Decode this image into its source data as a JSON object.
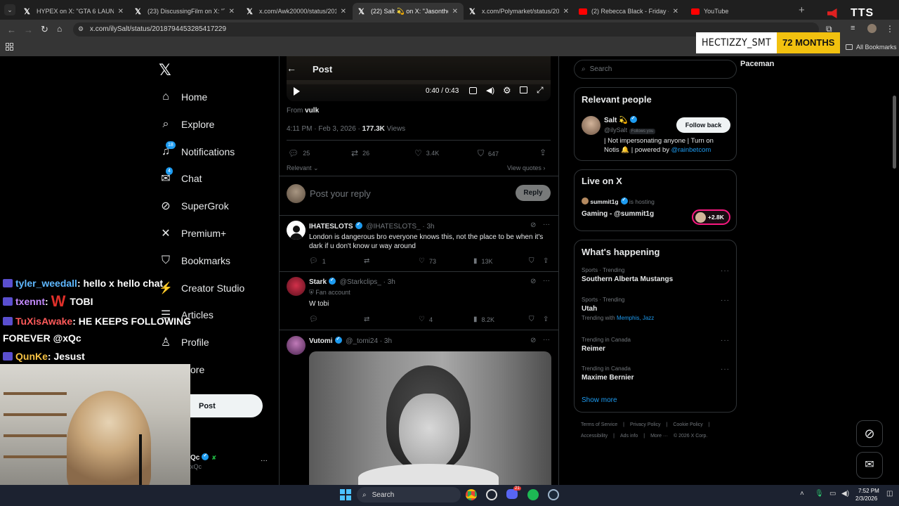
{
  "browser": {
    "tabs": [
      {
        "label": "HYPEX on X: \"GTA 6 LAUNCH M",
        "icon": "x-logo"
      },
      {
        "label": "(23) DiscussingFilm on X: \"Take",
        "icon": "x-logo"
      },
      {
        "label": "x.com/Awk20000/status/2018:",
        "icon": "x-logo"
      },
      {
        "label": "(22) Salt 💫 on X: \"Jasonthewe",
        "icon": "x-logo"
      },
      {
        "label": "x.com/Polymarket/status/2018",
        "icon": "x-logo"
      },
      {
        "label": "(2) Rebecca Black - Friday - You",
        "icon": "youtube"
      },
      {
        "label": "YouTube",
        "icon": "youtube"
      }
    ],
    "active_tab": 3,
    "url": "x.com/ilySalt/status/2018794453285417229",
    "all_bookmarks": "All Bookmarks"
  },
  "sub_badge": {
    "name": "HECTIZZY_SMT",
    "months": "72 MONTHS"
  },
  "tts_label": "TTS",
  "nav": {
    "items": [
      {
        "label": "Home",
        "icon": "home-icon"
      },
      {
        "label": "Explore",
        "icon": "search-icon"
      },
      {
        "label": "Notifications",
        "icon": "bell-icon",
        "badge": "18"
      },
      {
        "label": "Chat",
        "icon": "mail-icon",
        "badge": "4"
      },
      {
        "label": "SuperGrok",
        "icon": "grok-icon"
      },
      {
        "label": "Premium+",
        "icon": "x-icon"
      },
      {
        "label": "Bookmarks",
        "icon": "bookmark-icon"
      },
      {
        "label": "Creator Studio",
        "icon": "creator-icon"
      },
      {
        "label": "Articles",
        "icon": "article-icon"
      },
      {
        "label": "Profile",
        "icon": "person-icon"
      },
      {
        "label": "ore",
        "icon": "more-icon"
      }
    ],
    "post_button": "Post",
    "account_name": "Qc",
    "account_handle": "xQc"
  },
  "post": {
    "header_title": "Post",
    "video_time": "0:40 / 0:43",
    "from_label": "From",
    "from_name": "vulk",
    "time": "4:11 PM · Feb 3, 2026 · ",
    "views_count": "177.3K",
    "views_label": " Views",
    "stats": {
      "replies": "25",
      "reposts": "26",
      "likes": "3.4K",
      "bookmarks": "647"
    },
    "relevant": "Relevant",
    "view_quotes": "View quotes",
    "reply_placeholder": "Post your reply",
    "reply_button": "Reply"
  },
  "replies": [
    {
      "name": "IHATESLOTS",
      "handle": "@IHATESLOTS_ · 3h",
      "text": "London is dangerous bro everyone knows this, not the place to be when it's dark if u don't know ur way around",
      "stats": {
        "replies": "1",
        "reposts": "",
        "likes": "73",
        "views": "13K"
      }
    },
    {
      "name": "Stark",
      "handle": "@Starkclips_ · 3h",
      "badge": "Fan account",
      "text": "W tobi",
      "stats": {
        "replies": "",
        "reposts": "",
        "likes": "4",
        "views": "8.2K"
      }
    },
    {
      "name": "Vutomi",
      "handle": "@_tomi24 · 3h",
      "text": ""
    }
  ],
  "right": {
    "search_placeholder": "Search",
    "pacemann": "Paceman",
    "relevant_people": {
      "title": "Relevant people",
      "name": "Salt 💫",
      "handle": "@ilySalt",
      "follows_you": "Follows you",
      "bio_1": "| Not impersonating anyone | Turn on",
      "bio_2": "Notis 🔔 | powered by ",
      "bio_link": "@rainbetcom",
      "button": "Follow back"
    },
    "live": {
      "title": "Live on X",
      "host": "summit1g",
      "hosting": "is hosting",
      "stream": "Gaming - @summit1g",
      "count": "+2.8K"
    },
    "happening": {
      "title": "What's happening",
      "trends": [
        {
          "context": "Sports · Trending",
          "name": "Southern Alberta Mustangs",
          "sub": ""
        },
        {
          "context": "Sports · Trending",
          "name": "Utah",
          "sub": "Trending with ",
          "sub_links": "Memphis, Jazz"
        },
        {
          "context": "Trending in Canada",
          "name": "Reimer",
          "sub": ""
        },
        {
          "context": "Trending in Canada",
          "name": "Maxime Bernier",
          "sub": ""
        }
      ],
      "show_more": "Show more"
    },
    "footer_1": [
      "Terms of Service",
      "|",
      "Privacy Policy",
      "|",
      "Cookie Policy",
      "|"
    ],
    "footer_2": [
      "Accessibility",
      "|",
      "Ads info",
      "|",
      "More ···",
      "© 2026 X Corp."
    ]
  },
  "chat": [
    {
      "user": "tyler_weedall",
      "msg": "hello x hello chat",
      "color": "#5fb8ff"
    },
    {
      "user": "txennt",
      "msg": "TOBI",
      "color": "#c58cff",
      "emote": "W"
    },
    {
      "user": "TuXisAwake",
      "msg": "HE KEEPS FOLLOWING FOREVER @xQc",
      "color": "#ff5a5a"
    },
    {
      "user": "QunKe",
      "msg": "Jesust",
      "color": "#f6c244"
    }
  ],
  "taskbar": {
    "search": "Search",
    "time": "7:52 PM",
    "date": "2/3/2026",
    "discord_badge": "21"
  },
  "colors": {
    "accent": "#1d9bf0",
    "bg": "#000000",
    "border": "#2f3336",
    "muted": "#71767b"
  }
}
